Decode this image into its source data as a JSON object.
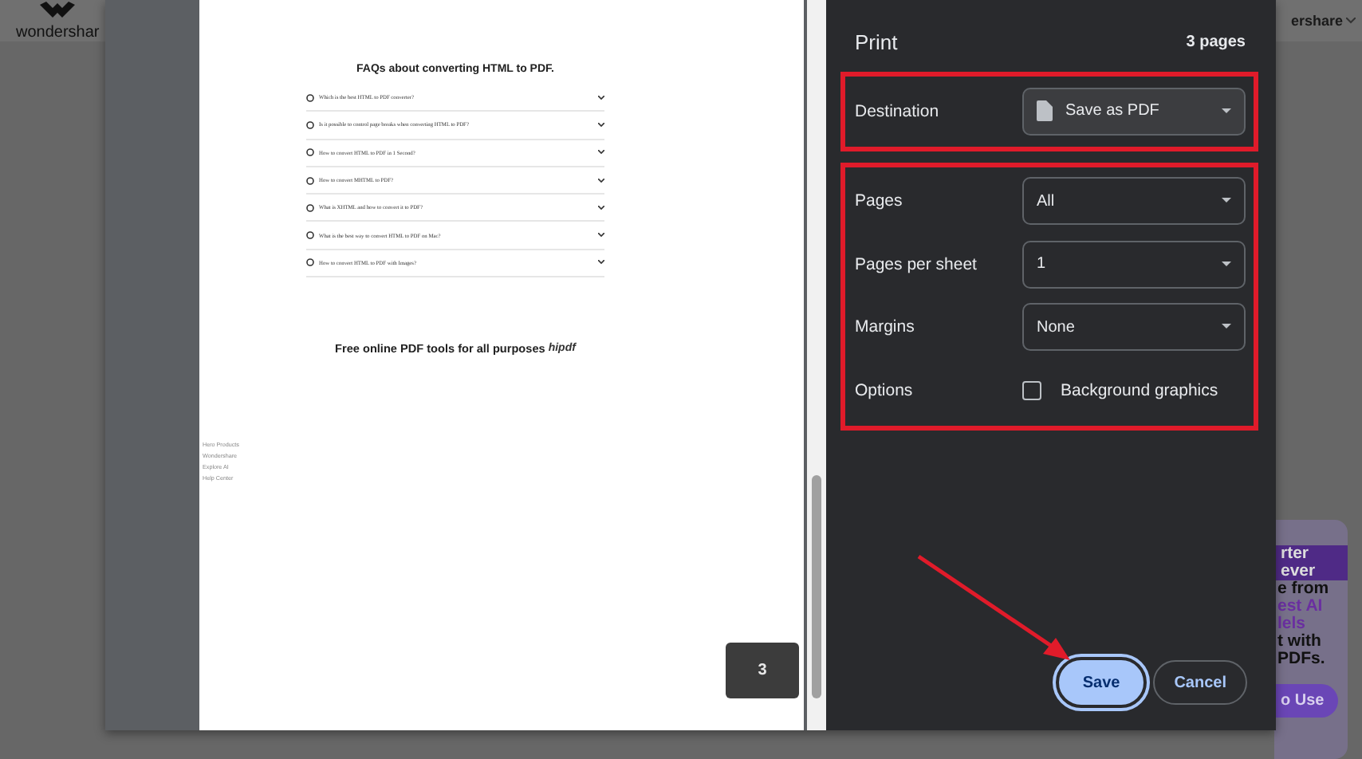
{
  "background_page": {
    "logo": "wondershar",
    "menu": "ershare",
    "ad_lines": [
      {
        "text": "rter",
        "kind": "band"
      },
      {
        "text": "ever",
        "kind": "band"
      },
      {
        "text": "e from",
        "kind": "plain"
      },
      {
        "text": "est AI",
        "kind": "accent"
      },
      {
        "text": "lels",
        "kind": "accent"
      },
      {
        "text": "t with",
        "kind": "plain"
      },
      {
        "text": "PDFs.",
        "kind": "plain"
      }
    ],
    "ad_button": "o Use"
  },
  "preview": {
    "faq_title": "FAQs about converting HTML to PDF.",
    "faqs": [
      "Which is the best HTML to PDF converter?",
      "Is it possible to control page breaks when converting HTML to PDF?",
      "How to convert HTML to PDF in 1 Second?",
      "How to convert MHTML to PDF?",
      "What is XHTML and how to convert it to PDF?",
      "What is the best way to convert HTML to PDF on Mac?",
      "How to convert HTML to PDF with Images?"
    ],
    "promo_title": "Free online PDF tools for all purposes",
    "promo_image_alt": "hipdf",
    "footer_links": [
      "Hero Products",
      "Wondershare",
      "Explore AI",
      "Help Center"
    ],
    "page_number": "3"
  },
  "print": {
    "title": "Print",
    "page_count": "3 pages",
    "groups": [
      {
        "highlighted": true,
        "settings": [
          {
            "kind": "destination",
            "label": "Destination",
            "value": "Save as PDF"
          }
        ]
      },
      {
        "highlighted": true,
        "settings": [
          {
            "kind": "select",
            "label": "Pages",
            "value": "All"
          },
          {
            "kind": "select",
            "label": "Pages per sheet",
            "value": "1"
          },
          {
            "kind": "select",
            "label": "Margins",
            "value": "None"
          },
          {
            "kind": "checkbox",
            "label": "Options",
            "value": "Background graphics",
            "checked": false
          }
        ]
      }
    ],
    "buttons": [
      {
        "label": "Save",
        "kind": "primary",
        "focused": true
      },
      {
        "label": "Cancel",
        "kind": "secondary",
        "focused": false
      }
    ],
    "arrow_to_save": true
  }
}
